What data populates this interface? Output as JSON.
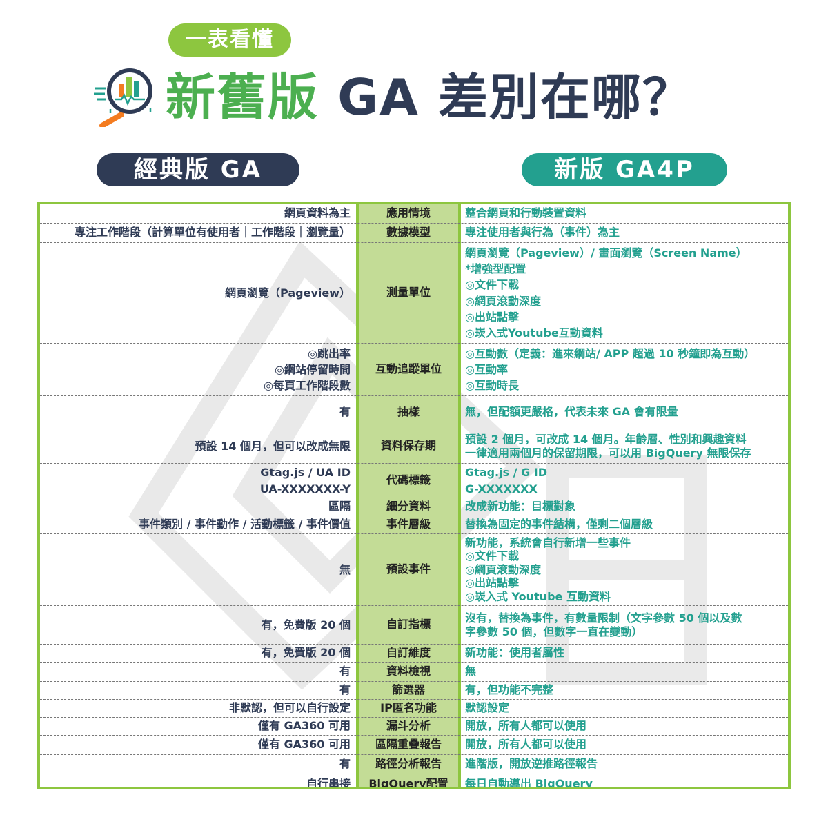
{
  "badge": "一表看懂",
  "title": {
    "accent": "新舊版",
    "rest": " GA 差別在哪？"
  },
  "headers": {
    "classic": "經典版 GA",
    "new": "新版 GA4P"
  },
  "rows": [
    {
      "classic": [
        "網頁資料為主"
      ],
      "feature": "應用情境",
      "ga4": [
        "整合網頁和行動裝置資料"
      ]
    },
    {
      "classic": [
        "專注工作階段（計算單位有使用者｜工作階段｜瀏覽量）"
      ],
      "feature": "數據模型",
      "ga4": [
        "專注使用者與行為（事件）為主"
      ]
    },
    {
      "classic": [
        "網頁瀏覽（Pageview）"
      ],
      "feature": "測量單位",
      "ga4": [
        "網頁瀏覽（Pageview）/ 畫面瀏覽（Screen Name）",
        "*增強型配置",
        "◎文件下載",
        "◎網頁滾動深度",
        "◎出站點擊",
        "◎崁入式Youtube互動資料"
      ]
    },
    {
      "classic": [
        "◎跳出率",
        "◎網站停留時間",
        "◎每頁工作階段數"
      ],
      "feature": "互動追蹤單位",
      "ga4": [
        "◎互動數（定義：進來網站/ APP 超過 10 秒鐘即為互動）",
        "◎互動率",
        "◎互動時長"
      ]
    },
    {
      "classic": [
        "有"
      ],
      "feature": "抽樣",
      "ga4": [
        "無，但配額更嚴格，代表未來 GA 會有限量"
      ]
    },
    {
      "classic": [
        "預設 14 個月，但可以改成無限"
      ],
      "feature": "資料保存期",
      "ga4": [
        "預設 2 個月，可改成 14 個月。年齡層、性別和興趣資料",
        "一律適用兩個月的保留期限，可以用 BigQuery 無限保存"
      ]
    },
    {
      "classic": [
        "Gtag.js / UA ID",
        "UA-XXXXXXX-Y"
      ],
      "feature": "代碼標籤",
      "ga4": [
        "Gtag.js / G ID",
        "G-XXXXXXX"
      ]
    },
    {
      "classic": [
        "區隔"
      ],
      "feature": "細分資料",
      "ga4": [
        "改成新功能：目標對象"
      ]
    },
    {
      "classic": [
        "事件類別 / 事件動作 / 活動標籤 / 事件價值"
      ],
      "feature": "事件層級",
      "ga4": [
        "替換為固定的事件結構，僅剩二個層級"
      ]
    },
    {
      "classic": [
        "無"
      ],
      "feature": "預設事件",
      "ga4": [
        "新功能，系統會自行新增一些事件",
        "◎文件下載",
        "◎網頁滾動深度",
        "◎出站點擊",
        "◎崁入式 Youtube 互動資料"
      ]
    },
    {
      "classic": [
        "有，免費版 20 個"
      ],
      "feature": "自訂指標",
      "ga4": [
        "沒有，替換為事件，有數量限制（文字參數 50 個以及數",
        "字參數 50 個，但數字一直在變動）"
      ]
    },
    {
      "classic": [
        "有，免費版 20 個"
      ],
      "feature": "自訂維度",
      "ga4": [
        "新功能：使用者屬性"
      ]
    },
    {
      "classic": [
        "有"
      ],
      "feature": "資料檢視",
      "ga4": [
        "無"
      ]
    },
    {
      "classic": [
        "有"
      ],
      "feature": "篩選器",
      "ga4": [
        "有，但功能不完整"
      ]
    },
    {
      "classic": [
        "非默認，但可以自行設定"
      ],
      "feature": "IP匿名功能",
      "ga4": [
        "默認設定"
      ]
    },
    {
      "classic": [
        "僅有 GA360 可用"
      ],
      "feature": "漏斗分析",
      "ga4": [
        "開放，所有人都可以使用"
      ]
    },
    {
      "classic": [
        "僅有 GA360 可用"
      ],
      "feature": "區隔重疊報告",
      "ga4": [
        "開放，所有人都可以使用"
      ]
    },
    {
      "classic": [
        "有"
      ],
      "feature": "路徑分析報告",
      "ga4": [
        "進階版，開放逆推路徑報告"
      ]
    },
    {
      "classic": [
        "自行串接"
      ],
      "feature": "BigQuery配置",
      "ga4": [
        "每日自動導出 BigQuery"
      ]
    }
  ],
  "colors": {
    "green": "#8dc63f",
    "teal": "#23a08f",
    "navy": "#2f3b55",
    "mid_bg": "#c3dc96"
  },
  "icons": {
    "logo": "magnifier-chart-icon"
  }
}
